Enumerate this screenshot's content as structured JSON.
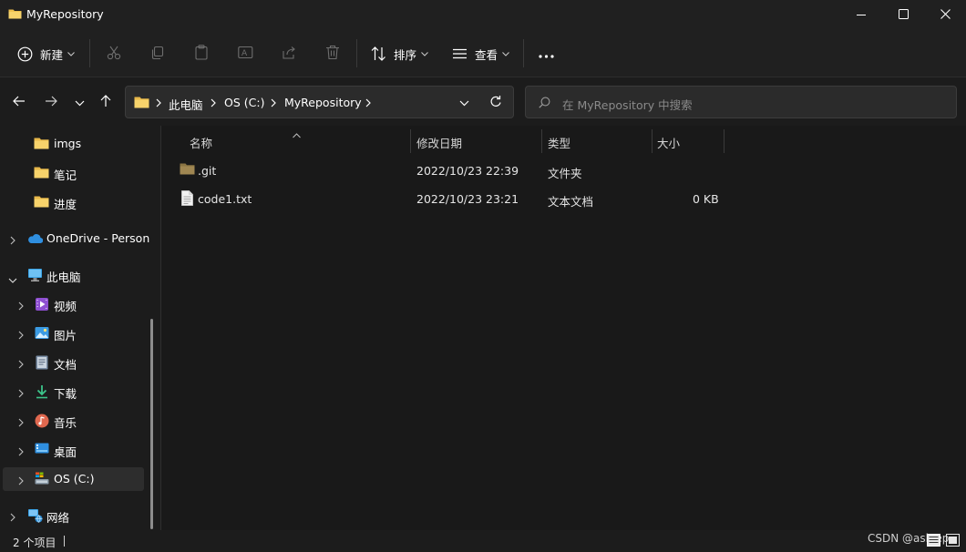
{
  "window": {
    "title": "MyRepository",
    "minimize_icon": "minimize-icon",
    "maximize_icon": "maximize-icon",
    "close_icon": "close-icon"
  },
  "toolbar": {
    "new_label": "新建",
    "sort_label": "排序",
    "view_label": "查看",
    "icons": [
      "new-icon",
      "cut-icon",
      "copy-icon",
      "paste-icon",
      "rename-icon",
      "share-icon",
      "delete-icon",
      "sort-icon",
      "view-icon",
      "more-icon"
    ]
  },
  "address": {
    "breadcrumbs": [
      "此电脑",
      "OS (C:)",
      "MyRepository"
    ]
  },
  "search": {
    "placeholder": "在 MyRepository 中搜索"
  },
  "sidebar": {
    "items": [
      {
        "label": "imgs",
        "icon": "folder-icon"
      },
      {
        "label": "笔记",
        "icon": "folder-icon"
      },
      {
        "label": "进度",
        "icon": "folder-icon"
      },
      {
        "label": "OneDrive - Person",
        "icon": "cloud-icon"
      },
      {
        "label": "此电脑",
        "icon": "computer-icon"
      },
      {
        "label": "视频",
        "icon": "video-icon"
      },
      {
        "label": "图片",
        "icon": "picture-icon"
      },
      {
        "label": "文档",
        "icon": "document-icon"
      },
      {
        "label": "下载",
        "icon": "download-icon"
      },
      {
        "label": "音乐",
        "icon": "music-icon"
      },
      {
        "label": "桌面",
        "icon": "desktop-icon"
      },
      {
        "label": "OS (C:)",
        "icon": "drive-icon"
      },
      {
        "label": "网络",
        "icon": "network-icon"
      }
    ]
  },
  "table": {
    "columns": [
      "名称",
      "修改日期",
      "类型",
      "大小"
    ],
    "rows": [
      {
        "name": ".git",
        "modified": "2022/10/23 22:39",
        "type": "文件夹",
        "size": "",
        "icon": "folder-icon"
      },
      {
        "name": "code1.txt",
        "modified": "2022/10/23 23:21",
        "type": "文本文档",
        "size": "0 KB",
        "icon": "text-file-icon"
      }
    ]
  },
  "status": {
    "item_count": "2 个项目",
    "watermark": "CSDN @asleep"
  },
  "colors": {
    "folder": "#e8b84a",
    "background": "#1c1c1c",
    "selected": "#2d2d2d"
  }
}
